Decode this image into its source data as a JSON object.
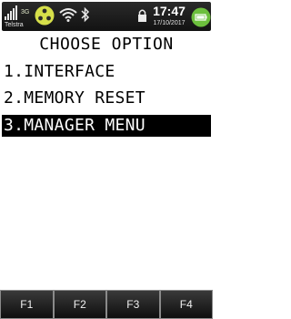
{
  "status_bar": {
    "network": "3G",
    "carrier": "Telstra",
    "time": "17:47",
    "date": "17/10/2017",
    "colors": {
      "background": "#1c1c1c",
      "sim_icon": "#d6df4a",
      "battery": "#6cbf3d"
    },
    "icons": [
      "signal-icon",
      "sim-card-icon",
      "wifi-icon",
      "bluetooth-icon",
      "lock-icon",
      "battery-icon"
    ]
  },
  "menu": {
    "title": "CHOOSE OPTION",
    "items": [
      {
        "label": "1.INTERFACE"
      },
      {
        "label": "2.MEMORY RESET"
      },
      {
        "label": "3.MANAGER MENU",
        "selected": true
      }
    ]
  },
  "function_keys": [
    "F1",
    "F2",
    "F3",
    "F4"
  ]
}
